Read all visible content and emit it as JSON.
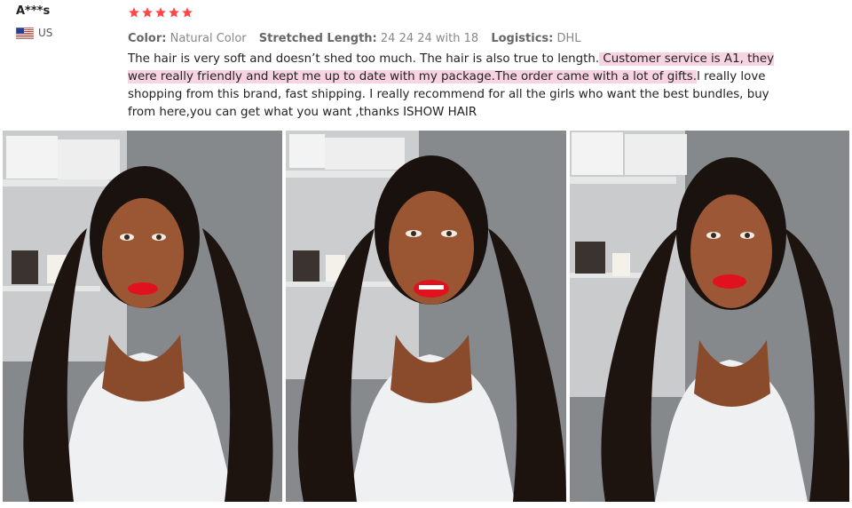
{
  "reviewer": {
    "name": "A***s",
    "country_code": "US",
    "flag_icon": "us-flag-icon"
  },
  "review": {
    "rating": 5,
    "star_color": "#ff4747",
    "attributes": [
      {
        "label": "Color:",
        "value": "Natural Color"
      },
      {
        "label": "Stretched Length:",
        "value": "24 24 24 with 18"
      },
      {
        "label": "Logistics:",
        "value": "DHL"
      }
    ],
    "text_part1": "The hair is very soft and doesn’t shed too much. The hair is also true to length.",
    "text_highlight1": " Customer service is A1, they were really friendly and kept me up to date with my package.",
    "text_part2": "The order came with a lot of gifts.",
    "text_part3": "I really love shopping from this brand, fast shipping. I really recommend for all the girls who want the best bundles, buy from here,you can get what you want ,thanks ISHOW HAIR",
    "highlight_color": "#f8d4e3"
  },
  "photos": [
    {
      "label": "review-photo-1"
    },
    {
      "label": "review-photo-2"
    },
    {
      "label": "review-photo-3"
    }
  ]
}
